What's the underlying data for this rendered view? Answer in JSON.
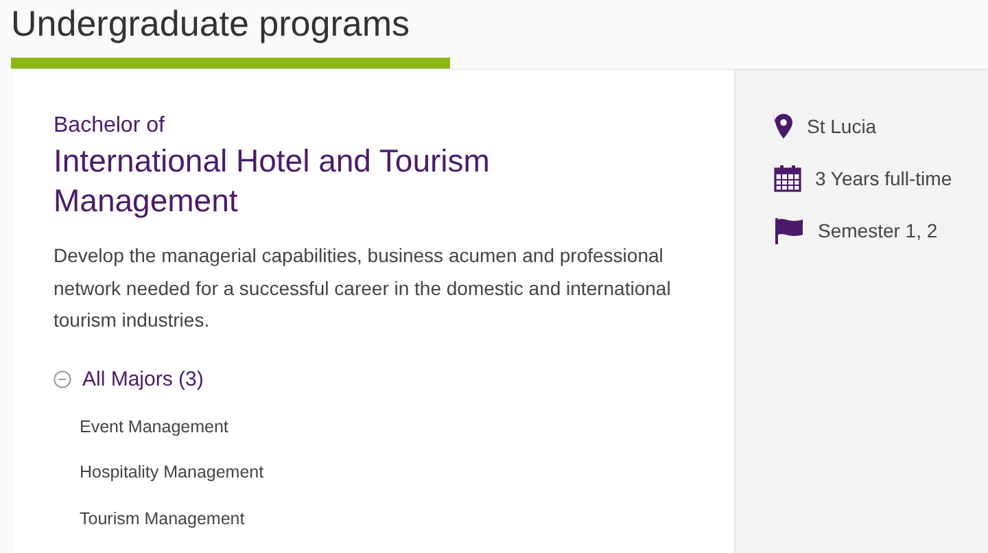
{
  "page_title": "Undergraduate programs",
  "program": {
    "prefix": "Bachelor of",
    "name": "International Hotel and Tourism Management",
    "description": "Develop the managerial capabilities, business acumen and professional network needed for a successful career in the domestic and international tourism industries."
  },
  "majors": {
    "label": "All Majors (3)",
    "expanded": true,
    "items": [
      "Event Management",
      "Hospitality Management",
      "Tourism Management"
    ]
  },
  "facts": [
    {
      "kind": "location",
      "text": "St Lucia"
    },
    {
      "kind": "duration",
      "text": "3 Years full-time"
    },
    {
      "kind": "semester",
      "text": "Semester 1, 2"
    }
  ]
}
